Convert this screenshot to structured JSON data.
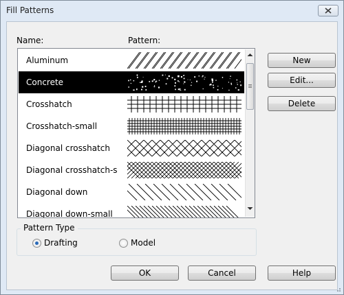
{
  "window": {
    "title": "Fill Patterns"
  },
  "columns": {
    "name": "Name:",
    "pattern": "Pattern:"
  },
  "patterns": [
    {
      "name": "Aluminum",
      "pattern": "diagonal-up-lines",
      "selected": false
    },
    {
      "name": "Concrete",
      "pattern": "concrete-speckle",
      "selected": true
    },
    {
      "name": "Crosshatch",
      "pattern": "orthogonal-grid",
      "selected": false
    },
    {
      "name": "Crosshatch-small",
      "pattern": "fine-orthogonal-grid",
      "selected": false
    },
    {
      "name": "Diagonal crosshatch",
      "pattern": "diagonal-grid",
      "selected": false
    },
    {
      "name": "Diagonal crosshatch-s",
      "pattern": "fine-diagonal-grid",
      "selected": false
    },
    {
      "name": "Diagonal down",
      "pattern": "diagonal-down-lines",
      "selected": false
    },
    {
      "name": "Diagonal down-small",
      "pattern": "fine-diagonal-down-lines",
      "selected": false
    }
  ],
  "side_buttons": {
    "new": "New",
    "edit": "Edit...",
    "delete": "Delete"
  },
  "pattern_type": {
    "title": "Pattern Type",
    "options": [
      {
        "label": "Drafting",
        "checked": true
      },
      {
        "label": "Model",
        "checked": false
      }
    ]
  },
  "footer_buttons": {
    "ok": "OK",
    "cancel": "Cancel",
    "help": "Help"
  },
  "colors": {
    "selection": "#000000",
    "dialog_frame": "#dfe9f5",
    "client": "#f0f0f0"
  }
}
